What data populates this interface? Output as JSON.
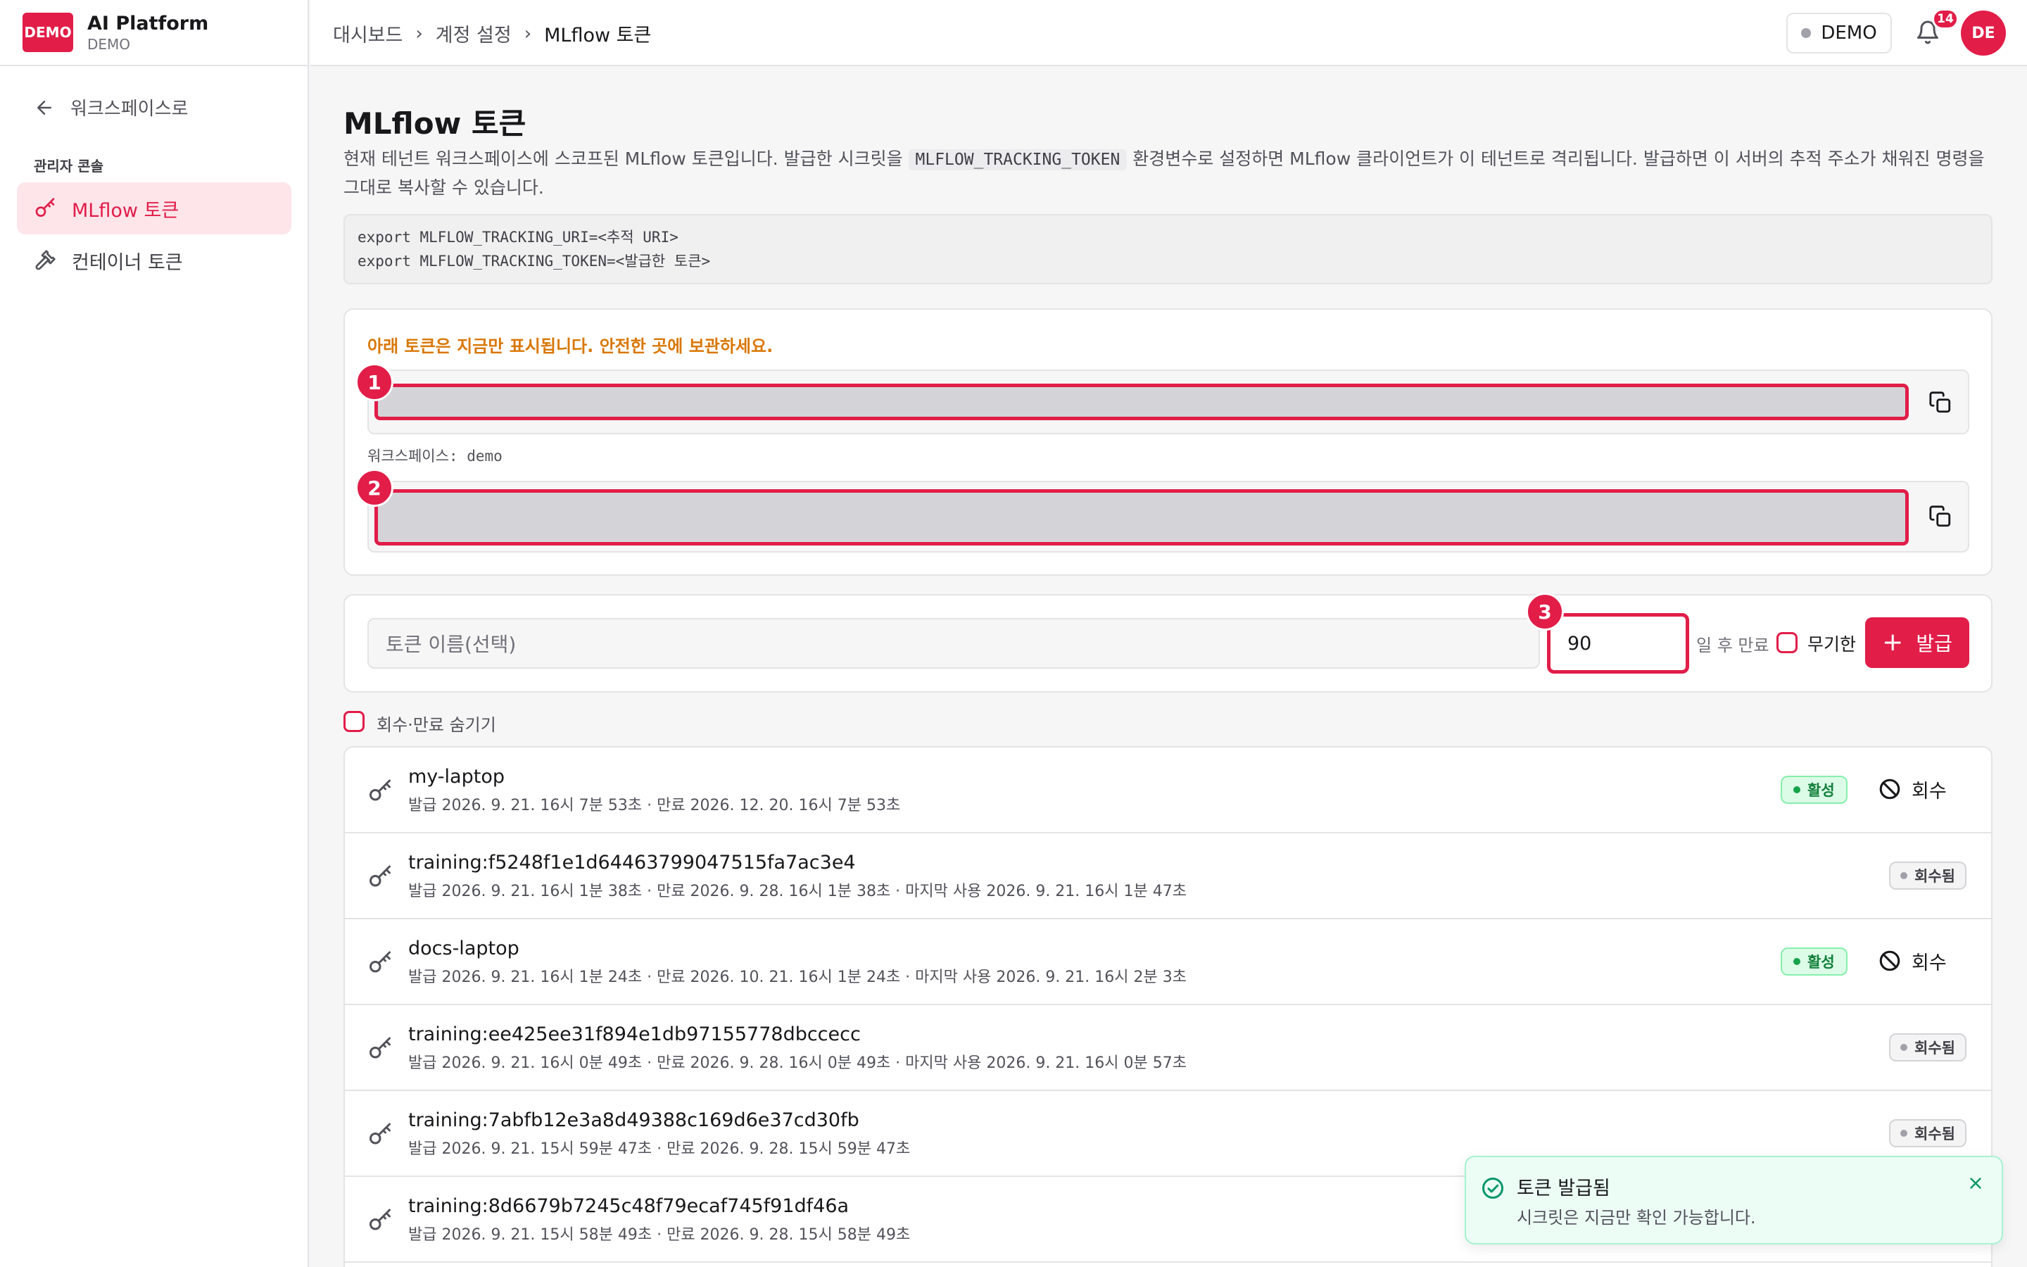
{
  "brand": {
    "logo_text": "DEMO",
    "name": "AI Platform",
    "subtitle": "DEMO"
  },
  "sidebar": {
    "back_label": "워크스페이스로",
    "section_label": "관리자 콘솔",
    "items": [
      {
        "label": "MLflow 토큰",
        "active": true,
        "icon": "key-icon"
      },
      {
        "label": "컨테이너 토큰",
        "active": false,
        "icon": "hammer-icon"
      }
    ]
  },
  "header": {
    "breadcrumb": [
      "대시보드",
      "계정 설정",
      "MLflow 토큰"
    ],
    "workspace_pill": "DEMO",
    "notification_count": "14",
    "avatar_initials": "DE"
  },
  "main": {
    "title": "MLflow 토큰",
    "desc_part1": "현재 테넌트 워크스페이스에 스코프된 MLflow 토큰입니다. 발급한 시크릿을 ",
    "desc_code": "MLFLOW_TRACKING_TOKEN",
    "desc_part2": " 환경변수로 설정하면 MLflow 클라이언트가 이 테넌트로 격리됩니다. 발급하면 이 서버의 추적 주소가 채워진 명령을 그대로 복사할 수 있습니다.",
    "code_lines": [
      "export MLFLOW_TRACKING_URI=<추적 URI>",
      "export MLFLOW_TRACKING_TOKEN=<발급한 토큰>"
    ]
  },
  "secret_card": {
    "notice": "아래 토큰은 지금만 표시됩니다. 안전한 곳에 보관하세요.",
    "workspace_label": "워크스페이스: demo",
    "markers": [
      "1",
      "2",
      "3"
    ]
  },
  "issue_form": {
    "name_placeholder": "토큰 이름(선택)",
    "days_value": "90",
    "days_suffix": "일 후 만료",
    "unlimited_label": "무기한",
    "issue_label": "발급"
  },
  "hide_toggle_label": "회수·만료 숨기기",
  "tokens": [
    {
      "name": "my-laptop",
      "meta": "발급 2026. 9. 21. 16시 7분 53초 · 만료 2026. 12. 20. 16시 7분 53초",
      "status": "활성",
      "action": "회수"
    },
    {
      "name": "training:f5248f1e1d64463799047515fa7ac3e4",
      "meta": "발급 2026. 9. 21. 16시 1분 38초 · 만료 2026. 9. 28. 16시 1분 38초 · 마지막 사용 2026. 9. 21. 16시 1분 47초",
      "status": "회수됨",
      "action": ""
    },
    {
      "name": "docs-laptop",
      "meta": "발급 2026. 9. 21. 16시 1분 24초 · 만료 2026. 10. 21. 16시 1분 24초 · 마지막 사용 2026. 9. 21. 16시 2분 3초",
      "status": "활성",
      "action": "회수"
    },
    {
      "name": "training:ee425ee31f894e1db97155778dbccecc",
      "meta": "발급 2026. 9. 21. 16시 0분 49초 · 만료 2026. 9. 28. 16시 0분 49초 · 마지막 사용 2026. 9. 21. 16시 0분 57초",
      "status": "회수됨",
      "action": ""
    },
    {
      "name": "training:7abfb12e3a8d49388c169d6e37cd30fb",
      "meta": "발급 2026. 9. 21. 15시 59분 47초 · 만료 2026. 9. 28. 15시 59분 47초",
      "status": "회수됨",
      "action": ""
    },
    {
      "name": "training:8d6679b7245c48f79ecaf745f91df46a",
      "meta": "발급 2026. 9. 21. 15시 58분 49초 · 만료 2026. 9. 28. 15시 58분 49초",
      "status": "",
      "action": ""
    }
  ],
  "toast": {
    "title": "토큰 발급됨",
    "message": "시크릿은 지금만 확인 가능합니다."
  },
  "colors": {
    "accent": "#e11d48",
    "active_bg": "#dcfce7",
    "warning": "#d97706"
  }
}
